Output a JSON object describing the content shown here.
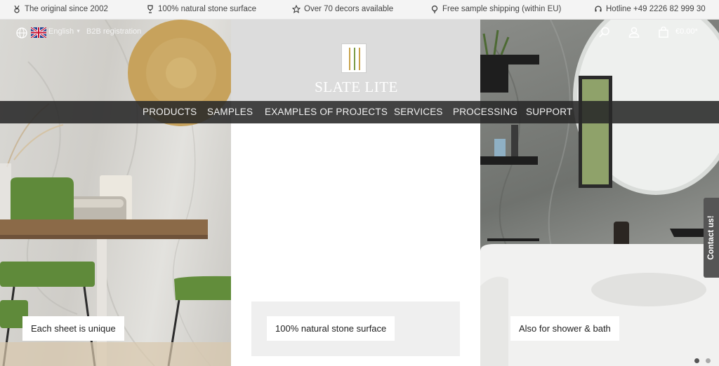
{
  "topbar": {
    "usps": [
      {
        "icon": "medal-icon",
        "text": "The original since 2002"
      },
      {
        "icon": "trophy-icon",
        "text": "100% natural stone surface"
      },
      {
        "icon": "star-icon",
        "text": "Over 70 decors available"
      },
      {
        "icon": "lightbulb-icon",
        "text": "Free sample shipping (within EU)"
      },
      {
        "icon": "headset-icon",
        "text": "Hotline +49 2226 82 999 30"
      }
    ]
  },
  "header": {
    "language": "English",
    "b2b_link": "B2B registration",
    "brand": "SLATE LITE",
    "cart_total": "€0.00*"
  },
  "nav": {
    "items": [
      "PRODUCTS",
      "SAMPLES",
      "EXAMPLES OF PROJECTS",
      "SERVICES",
      "PROCESSING",
      "SUPPORT"
    ]
  },
  "hero": {
    "captions": [
      "Each sheet is unique",
      "100% natural stone surface",
      "Also for shower & bath"
    ]
  },
  "contact": {
    "label": "Contact us!"
  },
  "colors": {
    "nav_bg": "#282828",
    "topbar_bg": "#f4f4f4",
    "logo_gold": "#c9a24a",
    "logo_green": "#7a9a45"
  }
}
